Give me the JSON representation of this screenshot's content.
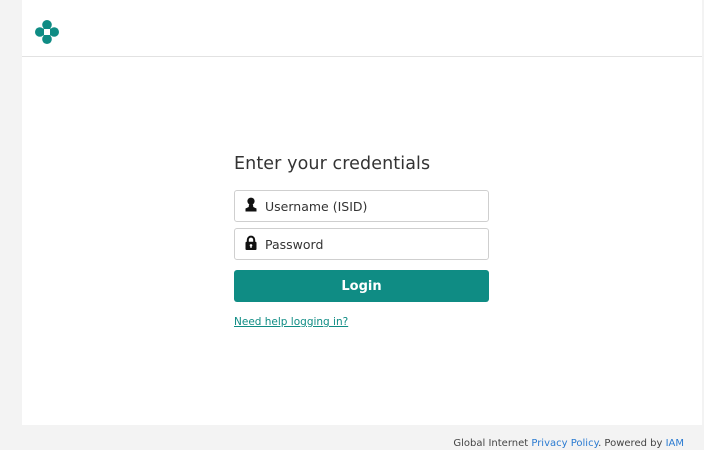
{
  "brand": {
    "logo_icon": "brand-logo-icon",
    "logo_color": "#0f8c84"
  },
  "form": {
    "title": "Enter your credentials",
    "username": {
      "placeholder": "Username (ISID)",
      "value": "",
      "icon": "user-icon"
    },
    "password": {
      "placeholder": "Password",
      "value": "",
      "icon": "lock-icon"
    },
    "login_label": "Login",
    "help_link": "Need help logging in?"
  },
  "footer": {
    "prefix": "Global Internet ",
    "privacy_link": "Privacy Policy",
    "middle": ". Powered by ",
    "iam_link": "IAM"
  },
  "colors": {
    "accent": "#0f8c84",
    "link_blue": "#2b7bd1",
    "background": "#f3f3f3",
    "card": "#ffffff"
  }
}
